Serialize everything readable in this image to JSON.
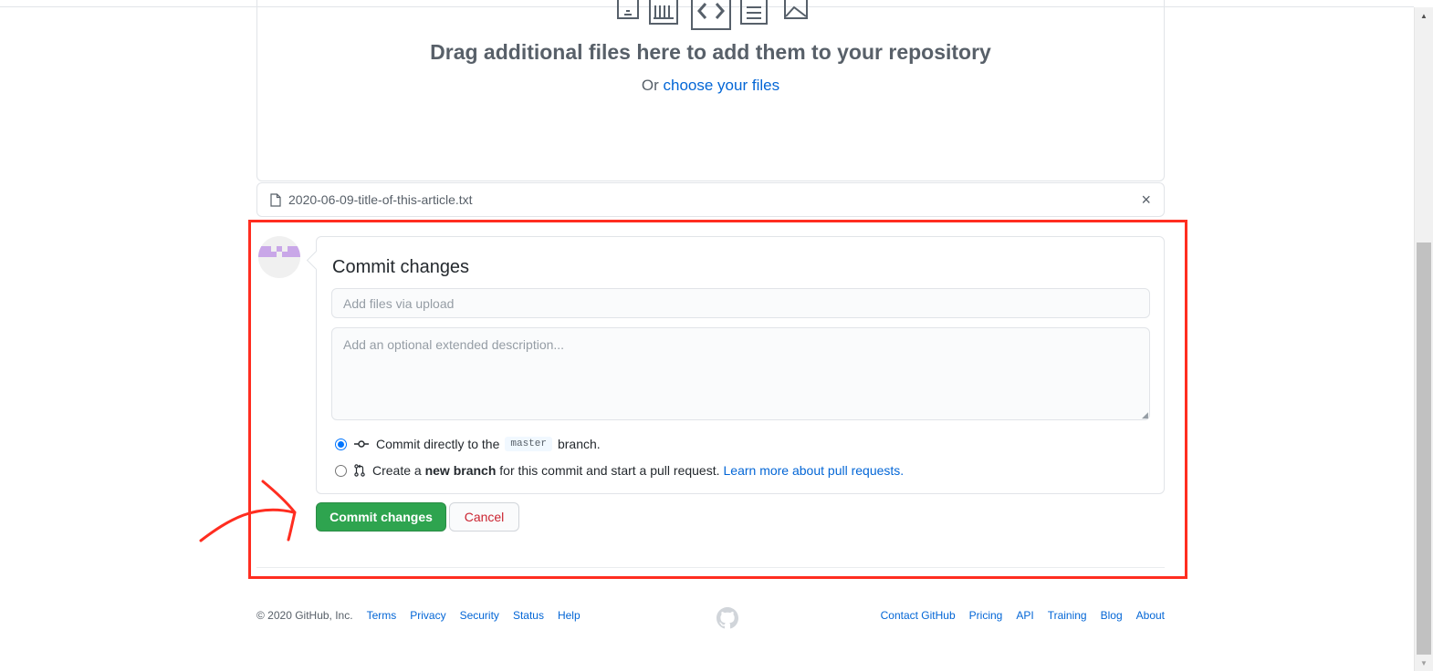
{
  "dropzone": {
    "title": "Drag additional files here to add them to your repository",
    "sub_prefix": "Or",
    "sub_link": "choose your files",
    "file_type_icons": [
      "image-file-icon",
      "archive-file-icon",
      "code-file-icon",
      "text-file-icon",
      "picture-file-icon"
    ]
  },
  "uploaded_file": {
    "name": "2020-06-09-title-of-this-article.txt",
    "remove_symbol": "×"
  },
  "commit": {
    "title": "Commit changes",
    "summary_placeholder": "Add files via upload",
    "description_placeholder": "Add an optional extended description...",
    "option_direct": {
      "prefix": "Commit directly to the",
      "branch": "master",
      "suffix": "branch.",
      "selected": true
    },
    "option_new_branch": {
      "prefix": "Create a",
      "bold": "new branch",
      "suffix": "for this commit and start a pull request.",
      "link": "Learn more about pull requests.",
      "selected": false
    },
    "commit_button": "Commit changes",
    "cancel_button": "Cancel"
  },
  "footer": {
    "copyright": "© 2020 GitHub, Inc.",
    "left_links": [
      "Terms",
      "Privacy",
      "Security",
      "Status",
      "Help"
    ],
    "right_links": [
      "Contact GitHub",
      "Pricing",
      "API",
      "Training",
      "Blog",
      "About"
    ]
  },
  "colors": {
    "primary_button": "#2ea44f",
    "link": "#0366d6",
    "cancel_text": "#cb2431",
    "annotation_red": "#ff2d20"
  }
}
